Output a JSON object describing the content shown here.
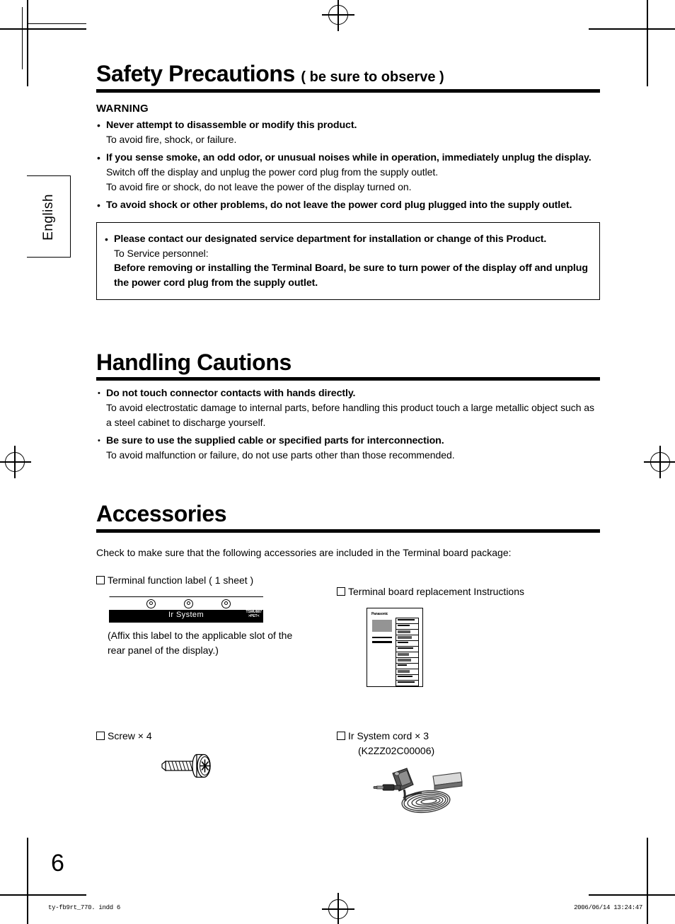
{
  "language_tab": "English",
  "safety": {
    "title": "Safety Precautions",
    "title_suffix": "( be sure to observe )",
    "warning_heading": "WARNING",
    "bullets": [
      {
        "title": "Never attempt to disassemble or modify this product.",
        "lines": [
          "To avoid fire, shock, or failure."
        ]
      },
      {
        "title": "If you sense smoke, an odd odor, or unusual noises while in operation, immediately unplug the display.",
        "lines": [
          "Switch off the display and unplug the power cord plug from the supply outlet.",
          "To avoid fire or shock, do not leave the power of the display turned on."
        ]
      },
      {
        "title": "To avoid shock or other problems, do not leave the power cord plug plugged into the supply outlet.",
        "lines": []
      }
    ],
    "notice_box": {
      "title": "Please contact our designated service department for installation or change of this Product.",
      "line_normal": "To Service personnel:",
      "line_bold": "Before removing or installing the Terminal Board, be sure to turn power of the display off and unplug the power cord plug from the supply outlet."
    }
  },
  "handling": {
    "title": "Handling Cautions",
    "bullets": [
      {
        "title": "Do not touch connector contacts with hands directly.",
        "lines": [
          "To avoid electrostatic damage to internal parts, before handling this product touch a large metallic object such as a steel cabinet to discharge yourself."
        ]
      },
      {
        "title": "Be sure to use the supplied cable or specified parts for interconnection.",
        "lines": [
          "To avoid malfunction or failure, do not use parts other than those recommended."
        ]
      }
    ]
  },
  "accessories": {
    "title": "Accessories",
    "lead": "Check to make sure that the following accessories are included in the Terminal board package:",
    "items": {
      "terminal_label": {
        "label": "Terminal function label ( 1 sheet )",
        "note_line1": "(Affix this label to the applicable slot of the",
        "note_line2": "rear panel of the display.)",
        "art_text": "Ir System",
        "art_recycle_line1": "TSMU887",
        "art_recycle_line2": ">PET<"
      },
      "instructions": {
        "label": "Terminal board replacement Instructions",
        "art_brand": "Panasonic"
      },
      "screw": {
        "label": "Screw × 4"
      },
      "ir_cord": {
        "label": "Ir System cord × 3",
        "part_number": "(K2ZZ02C00006)"
      }
    }
  },
  "page_number": "6",
  "footer": {
    "left": "ty-fb9rt_770. indd   6",
    "right": "2006/06/14   13:24:47"
  }
}
